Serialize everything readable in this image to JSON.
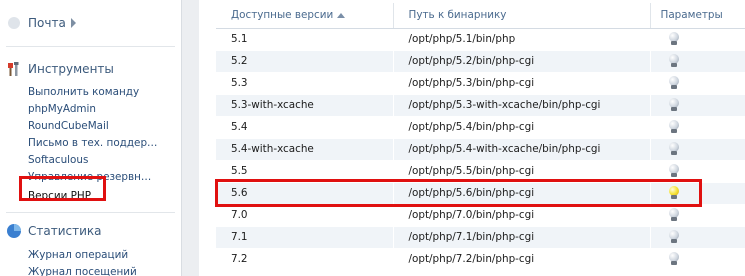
{
  "sidebar": {
    "mail": {
      "label": "Почта"
    },
    "tools": {
      "label": "Инструменты",
      "items": [
        "Выполнить команду",
        "phpMyAdmin",
        "RoundCubeMail",
        "Письмо в тех. поддер…",
        "Softaculous",
        "Управление резервн…",
        "Версии PHP"
      ]
    },
    "stats": {
      "label": "Статистика",
      "items": [
        "Журнал операций",
        "Журнал посещений"
      ]
    }
  },
  "table": {
    "headers": {
      "version": "Доступные версии",
      "path": "Путь к бинарнику",
      "params": "Параметры"
    },
    "rows": [
      {
        "version": "5.1",
        "path": "/opt/php/5.1/bin/php"
      },
      {
        "version": "5.2",
        "path": "/opt/php/5.2/bin/php-cgi"
      },
      {
        "version": "5.3",
        "path": "/opt/php/5.3/bin/php-cgi"
      },
      {
        "version": "5.3-with-xcache",
        "path": "/opt/php/5.3-with-xcache/bin/php-cgi"
      },
      {
        "version": "5.4",
        "path": "/opt/php/5.4/bin/php-cgi"
      },
      {
        "version": "5.4-with-xcache",
        "path": "/opt/php/5.4-with-xcache/bin/php-cgi"
      },
      {
        "version": "5.5",
        "path": "/opt/php/5.5/bin/php-cgi"
      },
      {
        "version": "5.6",
        "path": "/opt/php/5.6/bin/php-cgi"
      },
      {
        "version": "7.0",
        "path": "/opt/php/7.0/bin/php-cgi"
      },
      {
        "version": "7.1",
        "path": "/opt/php/7.1/bin/php-cgi"
      },
      {
        "version": "7.2",
        "path": "/opt/php/7.2/bin/php-cgi"
      }
    ]
  },
  "colors": {
    "highlight": "#e01010",
    "active_bulb": "#f5e43a"
  },
  "icons": {
    "mail_section": "chevron-right-icon",
    "tools_section": "tools-icon",
    "stats_section": "pie-chart-icon",
    "params": "lightbulb-icon"
  }
}
